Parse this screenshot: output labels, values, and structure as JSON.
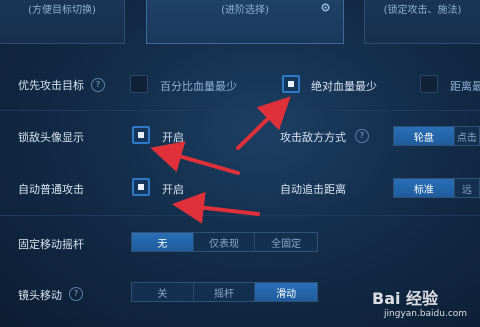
{
  "top_cards": [
    {
      "text": "(方便目标切换)"
    },
    {
      "text": "(进阶选择)"
    },
    {
      "text": "(锁定攻击、施法)"
    }
  ],
  "settings": {
    "priority_target": {
      "label": "优先攻击目标",
      "options": [
        {
          "text": "百分比血量最少",
          "checked": false
        },
        {
          "text": "绝对血量最少",
          "checked": true
        },
        {
          "text": "距离最近",
          "checked": false
        }
      ]
    },
    "lock_enemy_portrait": {
      "label": "锁敌头像显示",
      "option": "开启",
      "checked": true
    },
    "attack_enemy_mode": {
      "label": "攻击敌方方式",
      "options": [
        "轮盘",
        "点击"
      ],
      "active": 0
    },
    "auto_normal_attack": {
      "label": "自动普通攻击",
      "option": "开启",
      "checked": true
    },
    "auto_chase_distance": {
      "label": "自动追击距离",
      "options": [
        "标准",
        "远"
      ],
      "active": 0
    },
    "fixed_joystick": {
      "label": "固定移动摇杆",
      "options": [
        "无",
        "仅表现",
        "全固定"
      ],
      "active": 0
    },
    "camera_move": {
      "label": "镜头移动",
      "options": [
        "关",
        "摇杆",
        "滑动"
      ],
      "active": 2
    }
  },
  "help_icon": "?",
  "annotations": {
    "arrow_color": "#e0313a",
    "count": 3
  },
  "watermark": {
    "logo": "Bai 经验",
    "url": "jingyan.baidu.com"
  },
  "colors": {
    "accent": "#2a6fb6",
    "background": "#132c49",
    "arrow": "#e0313a"
  }
}
